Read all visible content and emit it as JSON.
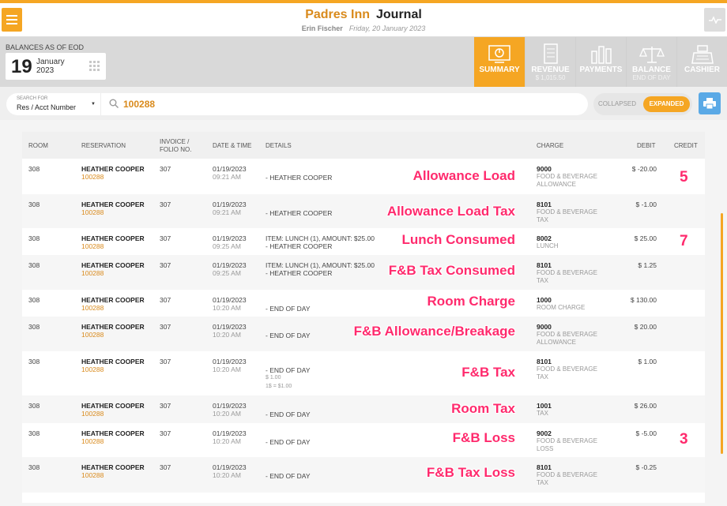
{
  "header": {
    "hotel": "Padres Inn",
    "module": "Journal",
    "user": "Erin Fischer",
    "date": "Friday, 20 January 2023"
  },
  "balances": {
    "label": "BALANCES AS OF EOD",
    "day": "19",
    "month": "January",
    "year": "2023"
  },
  "tabs": [
    {
      "label": "SUMMARY",
      "sub": "",
      "icon": "summary-icon"
    },
    {
      "label": "REVENUE",
      "sub": "$ 1,015.50",
      "icon": "receipt-icon"
    },
    {
      "label": "PAYMENTS",
      "sub": "",
      "icon": "bar-chart-icon"
    },
    {
      "label": "BALANCE",
      "sub": "END OF DAY",
      "icon": "scale-icon"
    },
    {
      "label": "CASHIER",
      "sub": "",
      "icon": "register-icon"
    }
  ],
  "search": {
    "type_label": "SEARCH FOR",
    "type_value": "Res / Acct Number",
    "value": "100288"
  },
  "view_toggle": {
    "collapsed": "COLLAPSED",
    "expanded": "EXPANDED"
  },
  "table": {
    "headers": {
      "room": "ROOM",
      "reservation": "RESERVATION",
      "invoice_1": "INVOICE /",
      "invoice_2": "FOLIO NO.",
      "datetime": "DATE & TIME",
      "details": "DETAILS",
      "charge": "CHARGE",
      "debit": "DEBIT",
      "credit": "CREDIT"
    },
    "rows": [
      {
        "room": "308",
        "name": "HEATHER COOPER",
        "res": "100288",
        "invoice": "307",
        "date": "01/19/2023",
        "time": "09:21 AM",
        "detail1": "",
        "detail2": "- HEATHER COOPER",
        "extra1": "",
        "extra2": "",
        "code": "9000",
        "desc1": "FOOD & BEVERAGE",
        "desc2": "ALLOWANCE",
        "debit": "$ -20.00",
        "annotation": "Allowance Load",
        "credit_mark": "5"
      },
      {
        "room": "308",
        "name": "HEATHER COOPER",
        "res": "100288",
        "invoice": "307",
        "date": "01/19/2023",
        "time": "09:21 AM",
        "detail1": "",
        "detail2": "- HEATHER COOPER",
        "extra1": "",
        "extra2": "",
        "code": "8101",
        "desc1": "FOOD & BEVERAGE",
        "desc2": "TAX",
        "debit": "$ -1.00",
        "annotation": "Allowance Load Tax",
        "credit_mark": ""
      },
      {
        "room": "308",
        "name": "HEATHER COOPER",
        "res": "100288",
        "invoice": "307",
        "date": "01/19/2023",
        "time": "09:25 AM",
        "detail1": "ITEM: LUNCH (1), AMOUNT: $25.00",
        "detail2": "- HEATHER COOPER",
        "extra1": "",
        "extra2": "",
        "code": "8002",
        "desc1": "LUNCH",
        "desc2": "",
        "debit": "$ 25.00",
        "annotation": "Lunch Consumed",
        "credit_mark": "7"
      },
      {
        "room": "308",
        "name": "HEATHER COOPER",
        "res": "100288",
        "invoice": "307",
        "date": "01/19/2023",
        "time": "09:25 AM",
        "detail1": "ITEM: LUNCH (1), AMOUNT: $25.00",
        "detail2": "- HEATHER COOPER",
        "extra1": "",
        "extra2": "",
        "code": "8101",
        "desc1": "FOOD & BEVERAGE",
        "desc2": "TAX",
        "debit": "$ 1.25",
        "annotation": "F&B Tax Consumed",
        "credit_mark": ""
      },
      {
        "room": "308",
        "name": "HEATHER COOPER",
        "res": "100288",
        "invoice": "307",
        "date": "01/19/2023",
        "time": "10:20 AM",
        "detail1": "",
        "detail2": "- END OF DAY",
        "extra1": "",
        "extra2": "",
        "code": "1000",
        "desc1": "ROOM CHARGE",
        "desc2": "",
        "debit": "$ 130.00",
        "annotation": "Room Charge",
        "credit_mark": ""
      },
      {
        "room": "308",
        "name": "HEATHER COOPER",
        "res": "100288",
        "invoice": "307",
        "date": "01/19/2023",
        "time": "10:20 AM",
        "detail1": "",
        "detail2": "- END OF DAY",
        "extra1": "",
        "extra2": "",
        "code": "9000",
        "desc1": "FOOD & BEVERAGE",
        "desc2": "ALLOWANCE",
        "debit": "$ 20.00",
        "annotation": "F&B Allowance/Breakage",
        "credit_mark": ""
      },
      {
        "room": "308",
        "name": "HEATHER COOPER",
        "res": "100288",
        "invoice": "307",
        "date": "01/19/2023",
        "time": "10:20 AM",
        "detail1": "",
        "detail2": "- END OF DAY",
        "extra1": "$ 1.00",
        "extra2": "1$ = $1.00",
        "code": "8101",
        "desc1": "FOOD & BEVERAGE",
        "desc2": "TAX",
        "debit": "$ 1.00",
        "annotation": "F&B Tax",
        "credit_mark": ""
      },
      {
        "room": "308",
        "name": "HEATHER COOPER",
        "res": "100288",
        "invoice": "307",
        "date": "01/19/2023",
        "time": "10:20 AM",
        "detail1": "",
        "detail2": "- END OF DAY",
        "extra1": "",
        "extra2": "",
        "code": "1001",
        "desc1": "TAX",
        "desc2": "",
        "debit": "$ 26.00",
        "annotation": "Room Tax",
        "credit_mark": ""
      },
      {
        "room": "308",
        "name": "HEATHER COOPER",
        "res": "100288",
        "invoice": "307",
        "date": "01/19/2023",
        "time": "10:20 AM",
        "detail1": "",
        "detail2": "- END OF DAY",
        "extra1": "",
        "extra2": "",
        "code": "9002",
        "desc1": "FOOD & BEVERAGE",
        "desc2": "LOSS",
        "debit": "$ -5.00",
        "annotation": "F&B Loss",
        "credit_mark": "3"
      },
      {
        "room": "308",
        "name": "HEATHER COOPER",
        "res": "100288",
        "invoice": "307",
        "date": "01/19/2023",
        "time": "10:20 AM",
        "detail1": "",
        "detail2": "- END OF DAY",
        "extra1": "",
        "extra2": "",
        "code": "8101",
        "desc1": "FOOD & BEVERAGE",
        "desc2": "TAX",
        "debit": "$ -0.25",
        "annotation": "F&B Tax Loss",
        "credit_mark": ""
      }
    ]
  },
  "colors": {
    "accent": "#f5a623",
    "accent_text": "#d98a1c",
    "annotation": "#ff2a6d",
    "print_button": "#5aa9e6"
  }
}
